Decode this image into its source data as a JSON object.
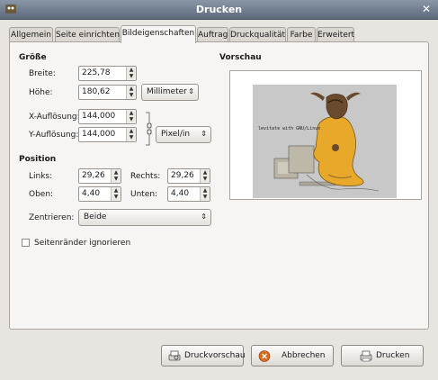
{
  "window": {
    "title": "Drucken"
  },
  "tabs": [
    {
      "label": "Allgemein"
    },
    {
      "label": "Seite einrichten"
    },
    {
      "label": "Bildeigenschaften"
    },
    {
      "label": "Auftrag"
    },
    {
      "label": "Druckqualität"
    },
    {
      "label": "Farbe"
    },
    {
      "label": "Erweitert"
    }
  ],
  "size": {
    "heading": "Größe",
    "width": {
      "label": "Breite:",
      "value": "225,78"
    },
    "height": {
      "label": "Höhe:",
      "value": "180,62"
    },
    "unit": "Millimeter",
    "x_res": {
      "label": "X-Auflösung:",
      "value": "144,000"
    },
    "y_res": {
      "label": "Y-Auflösung:",
      "value": "144,000"
    },
    "res_unit": "Pixel/in"
  },
  "position": {
    "heading": "Position",
    "left": {
      "label": "Links:",
      "value": "29,26"
    },
    "right": {
      "label": "Rechts:",
      "value": "29,26"
    },
    "top": {
      "label": "Oben:",
      "value": "4,40"
    },
    "bottom": {
      "label": "Unten:",
      "value": "4,40"
    },
    "center": {
      "label": "Zentrieren:",
      "value": "Beide"
    }
  },
  "ignore_margins": {
    "label": "Seitenränder ignorieren",
    "checked": false
  },
  "preview": {
    "heading": "Vorschau",
    "image_text": "levitate with GNU/Linux"
  },
  "buttons": {
    "preview": "Druckvorschau",
    "cancel": "Abbrechen",
    "print": "Drucken"
  }
}
